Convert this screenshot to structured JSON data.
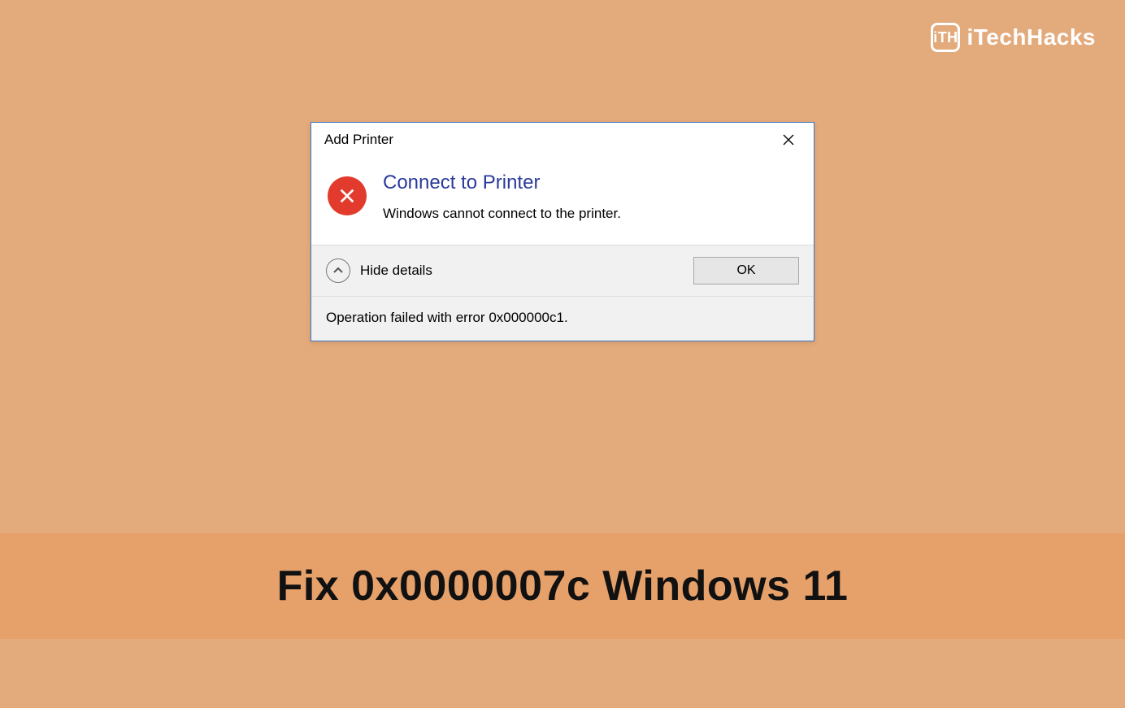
{
  "brand": {
    "logo_text": "iTH",
    "name": "iTechHacks"
  },
  "dialog": {
    "title": "Add Printer",
    "heading": "Connect to Printer",
    "message": "Windows cannot connect to the printer.",
    "toggle_label": "Hide details",
    "ok_label": "OK",
    "details": "Operation failed with error 0x000000c1."
  },
  "headline": "Fix 0x0000007c Windows 11"
}
